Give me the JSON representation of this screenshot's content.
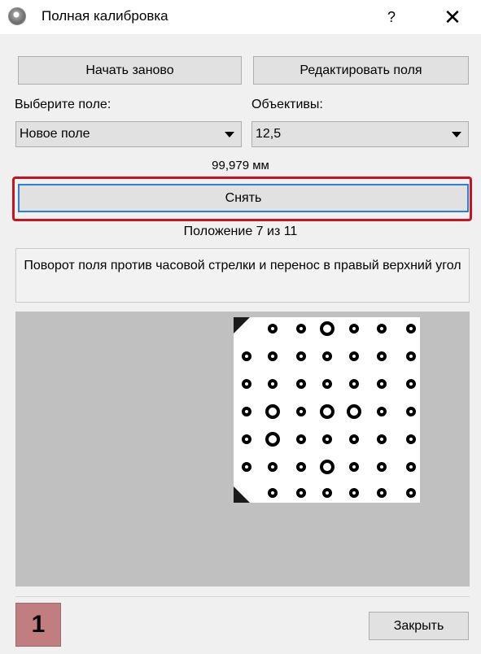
{
  "window": {
    "title": "Полная калибровка",
    "help_label": "?",
    "close_label": "✕"
  },
  "toolbar": {
    "restart_label": "Начать заново",
    "edit_fields_label": "Редактировать поля"
  },
  "field_select": {
    "label": "Выберите поле:",
    "value": "Новое поле"
  },
  "lens_select": {
    "label": "Объективы:",
    "value": "12,5"
  },
  "measurement": "99,979 мм",
  "capture_label": "Снять",
  "position_status": "Положение 7 из 11",
  "instruction": "Поворот поля против часовой стрелки и перенос в правый верхний угол",
  "step_badge": "1",
  "footer": {
    "close_label": "Закрыть"
  },
  "colors": {
    "highlight": "#c8141e",
    "focus_border": "#2b7fd4",
    "badge": "#c27d80",
    "preview_bg": "#c0c0c0"
  }
}
